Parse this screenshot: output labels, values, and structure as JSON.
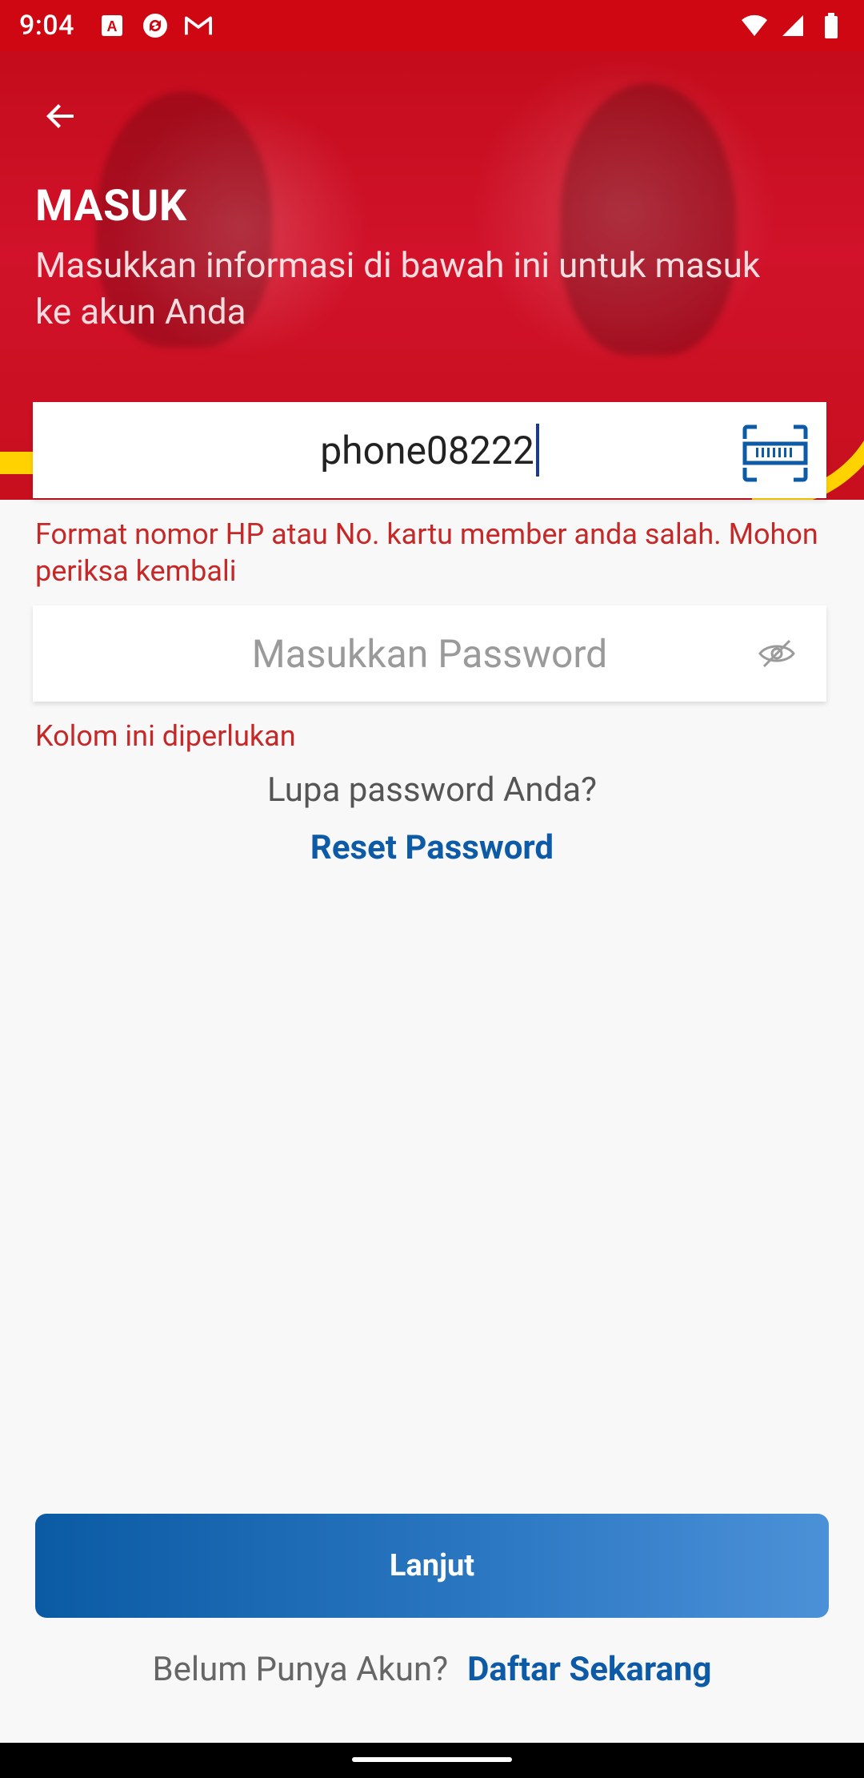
{
  "status_bar": {
    "time": "9:04",
    "left_icons": [
      "adobe-icon",
      "sync-icon",
      "gmail-icon"
    ],
    "right_icons": [
      "wifi-icon",
      "signal-icon",
      "battery-icon"
    ]
  },
  "header": {
    "title": "MASUK",
    "subtitle": "Masukkan informasi di bawah ini untuk masuk ke akun Anda"
  },
  "form": {
    "phone": {
      "value": "phone08222",
      "error": "Format nomor HP atau No. kartu member anda salah. Mohon periksa kembali"
    },
    "password": {
      "placeholder": "Masukkan Password",
      "error": "Kolom ini diperlukan"
    },
    "forgot_text": "Lupa password Anda?",
    "reset_label": "Reset Password",
    "submit_label": "Lanjut",
    "register_question": "Belum Punya Akun?",
    "register_link": "Daftar Sekarang"
  },
  "colors": {
    "brand_red": "#cf0712",
    "accent_yellow": "#ffd200",
    "link_blue": "#0d5aa7",
    "error_red": "#c62828"
  }
}
